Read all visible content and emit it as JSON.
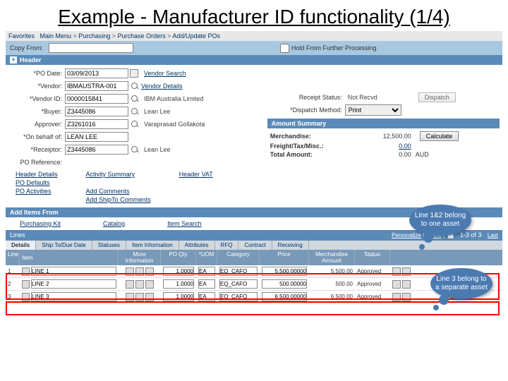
{
  "title": "Example - Manufacturer ID functionality (1/4)",
  "breadcrumb": {
    "fav": "Favorites",
    "main": "Main Menu",
    "p1": "Purchasing",
    "p2": "Purchase Orders",
    "p3": "Add/Update POs"
  },
  "topbar": {
    "copyFrom": "Copy From:",
    "hold": "Hold From Further Processing"
  },
  "sections": {
    "header": "Header",
    "amount": "Amount Summary",
    "addItems": "Add Items From",
    "lines": "Lines"
  },
  "form": {
    "poDate": {
      "label": "PO Date:",
      "value": "03/09/2013"
    },
    "vendor": {
      "label": "Vendor:",
      "value": "IBMAUSTRA-001",
      "link": "Vendor Search"
    },
    "vendorDetails": "Vendor Details",
    "vendorId": {
      "label": "Vendor ID:",
      "value": "0000015841",
      "desc": "IBM Australia Limited"
    },
    "buyer": {
      "label": "Buyer:",
      "value": "Z3445086",
      "desc": "Lean Lee"
    },
    "approver": {
      "label": "Approver:",
      "value": "Z3261016",
      "desc": "Varaprasad Gollakota"
    },
    "onBehalf": {
      "label": "On behalf of:",
      "value": "LEAN LEE"
    },
    "receiptor": {
      "label": "Receiptor:",
      "value": "Z3445086",
      "desc": "Lean Lee"
    },
    "poRef": {
      "label": "PO Reference:"
    },
    "receiptStatus": {
      "label": "Receipt Status:",
      "value": "Not Recvd"
    },
    "dispatchMethod": {
      "label": "Dispatch Method:",
      "value": "Print"
    },
    "dispatchBtn": "Dispatch"
  },
  "links": {
    "headerDetails": "Header Details",
    "poDefaults": "PO Defaults",
    "poActivities": "PO Activities",
    "activitySummary": "Activity Summary",
    "addComments": "Add Comments",
    "addShipTo": "Add ShipTo Comments",
    "headerVAT": "Header VAT",
    "purchasingKit": "Purchasing Kit",
    "catalog": "Catalog",
    "itemSearch": "Item Search"
  },
  "amount": {
    "merch": {
      "label": "Merchandise:",
      "value": "12,500.00"
    },
    "freight": {
      "label": "Freight/Tax/Misc.:",
      "value": "0.00"
    },
    "total": {
      "label": "Total Amount:",
      "value": "0.00",
      "cur": "AUD"
    },
    "calcBtn": "Calculate"
  },
  "linesBar": {
    "personalize": "Personalize",
    "find": "Find",
    "count": "1-3 of 3",
    "last": "Last"
  },
  "tabs": [
    "Details",
    "Ship To/Due Date",
    "Statuses",
    "Item Information",
    "Attributes",
    "RFQ",
    "Contract",
    "Receiving"
  ],
  "gridHead": {
    "line": "Line",
    "item": "Item",
    "more": "More Information",
    "qty": "PO Qty",
    "uom": "*UOM",
    "cat": "Category",
    "price": "Price",
    "amt": "Merchandise Amount",
    "status": "Status"
  },
  "rows": [
    {
      "line": "1",
      "item": "LINE 1",
      "qty": "1.0000",
      "uom": "EA",
      "cat": "EQ_CAFO",
      "price": "5,500.00000",
      "amt": "5,500.00",
      "status": "Approved"
    },
    {
      "line": "2",
      "item": "LINE 2",
      "qty": "1.0000",
      "uom": "EA",
      "cat": "EQ_CAFO",
      "price": "500.00000",
      "amt": "500.00",
      "status": "Approved"
    },
    {
      "line": "3",
      "item": "LINE 3",
      "qty": "1.0000",
      "uom": "EA",
      "cat": "EQ_CAFO",
      "price": "6,500.00000",
      "amt": "6,500.00",
      "status": "Approved"
    }
  ],
  "callouts": {
    "c1": "Line 1&2 belong to one asset",
    "c2": "Line 3 belong to a separate asset"
  }
}
